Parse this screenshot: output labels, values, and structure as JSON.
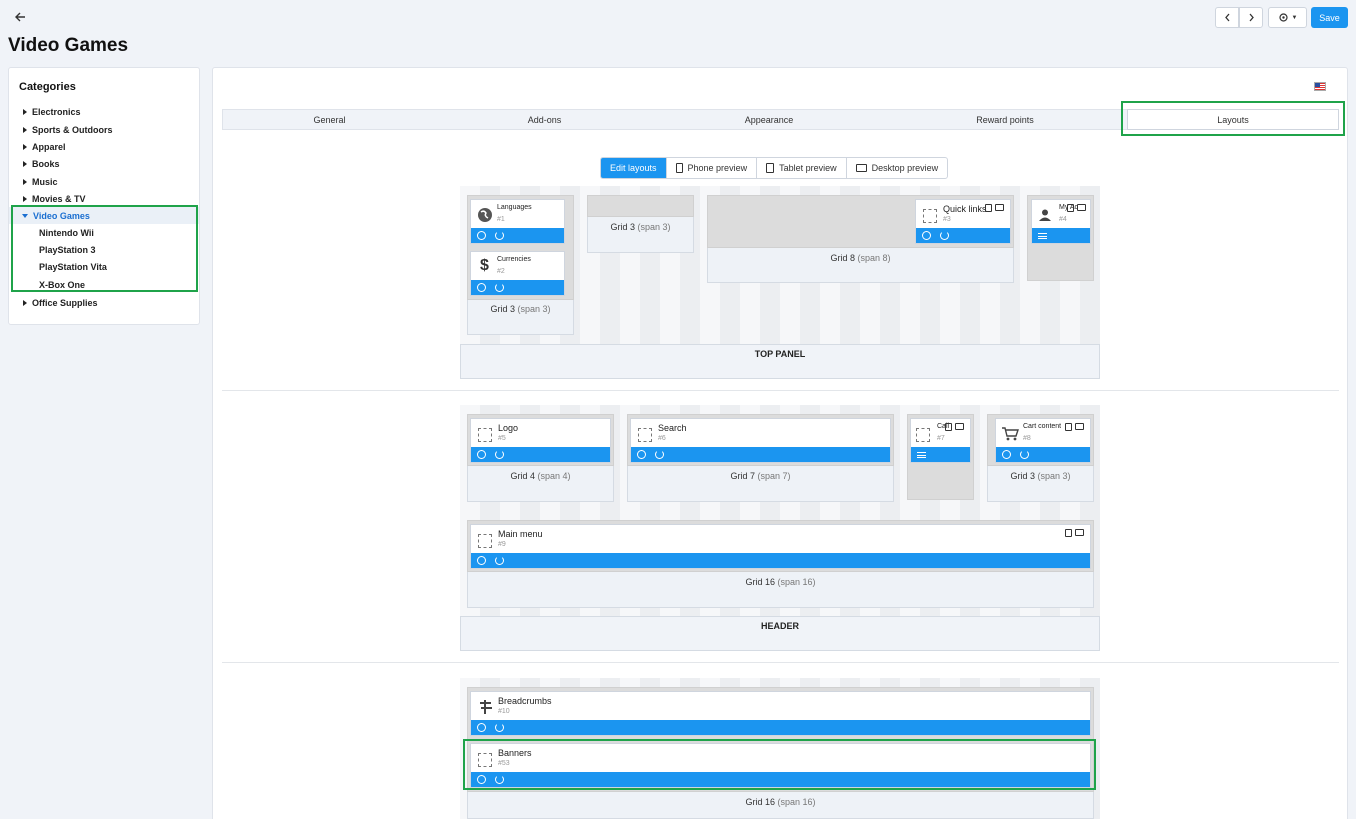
{
  "header": {
    "back_icon": "arrow-left-icon",
    "title": "Video Games",
    "prev_icon": "chevron-left-icon",
    "next_icon": "chevron-right-icon",
    "settings_icon": "gear-icon",
    "save_label": "Save",
    "accent": "#1b95f0"
  },
  "sidebar": {
    "title": "Categories",
    "items": [
      {
        "label": "Electronics"
      },
      {
        "label": "Sports & Outdoors"
      },
      {
        "label": "Apparel"
      },
      {
        "label": "Books"
      },
      {
        "label": "Music"
      },
      {
        "label": "Movies & TV"
      },
      {
        "label": "Video Games",
        "expanded": true,
        "active": true
      },
      {
        "label": "Office Supplies"
      }
    ],
    "subitems": [
      "Nintendo Wii",
      "PlayStation 3",
      "PlayStation Vita",
      "X-Box One"
    ]
  },
  "tabs": [
    "General",
    "Add-ons",
    "Appearance",
    "Reward points",
    "Layouts"
  ],
  "active_tab": "Layouts",
  "view_modes": [
    "Edit layouts",
    "Phone preview",
    "Tablet preview",
    "Desktop preview"
  ],
  "active_view_mode": "Edit layouts",
  "layout": {
    "top_panel": {
      "label": "TOP PANEL",
      "grids": [
        {
          "name": "Grid 3",
          "span": "(span 3)",
          "blocks": [
            {
              "name": "Languages",
              "id": "#1",
              "icon": "globe-icon"
            },
            {
              "name": "Currencies",
              "id": "#2",
              "icon": "dollar-icon"
            }
          ]
        },
        {
          "name": "Grid 3",
          "span": "(span 3)",
          "blocks": []
        },
        {
          "name": "Grid 8",
          "span": "(span 8)",
          "blocks": [
            {
              "name": "Quick links",
              "id": "#3",
              "icon": "placeholder-icon"
            }
          ]
        },
        {
          "name": "",
          "span": "",
          "blocks": [
            {
              "name": "My Ac",
              "id": "#4",
              "icon": "user-icon"
            }
          ]
        }
      ]
    },
    "header": {
      "label": "HEADER",
      "grids": [
        {
          "name": "Grid 4",
          "span": "(span 4)",
          "blocks": [
            {
              "name": "Logo",
              "id": "#5",
              "icon": "placeholder-icon"
            }
          ]
        },
        {
          "name": "Grid 7",
          "span": "(span 7)",
          "blocks": [
            {
              "name": "Search",
              "id": "#6",
              "icon": "placeholder-icon"
            }
          ]
        },
        {
          "name": "",
          "span": "",
          "blocks": [
            {
              "name": "Call",
              "id": "#7",
              "icon": "placeholder-icon"
            }
          ]
        },
        {
          "name": "Grid 3",
          "span": "(span 3)",
          "blocks": [
            {
              "name": "Cart content",
              "id": "#8",
              "icon": "cart-icon"
            }
          ]
        },
        {
          "name": "Grid 16",
          "span": "(span 16)",
          "blocks": [
            {
              "name": "Main menu",
              "id": "#9",
              "icon": "placeholder-icon"
            }
          ]
        }
      ]
    },
    "content": {
      "grids": [
        {
          "name": "Grid 16",
          "span": "(span 16)",
          "blocks": [
            {
              "name": "Breadcrumbs",
              "id": "#10",
              "icon": "signpost-icon"
            },
            {
              "name": "Banners",
              "id": "#53",
              "icon": "placeholder-icon"
            }
          ]
        }
      ]
    }
  },
  "highlight_color": "#1fa34a"
}
